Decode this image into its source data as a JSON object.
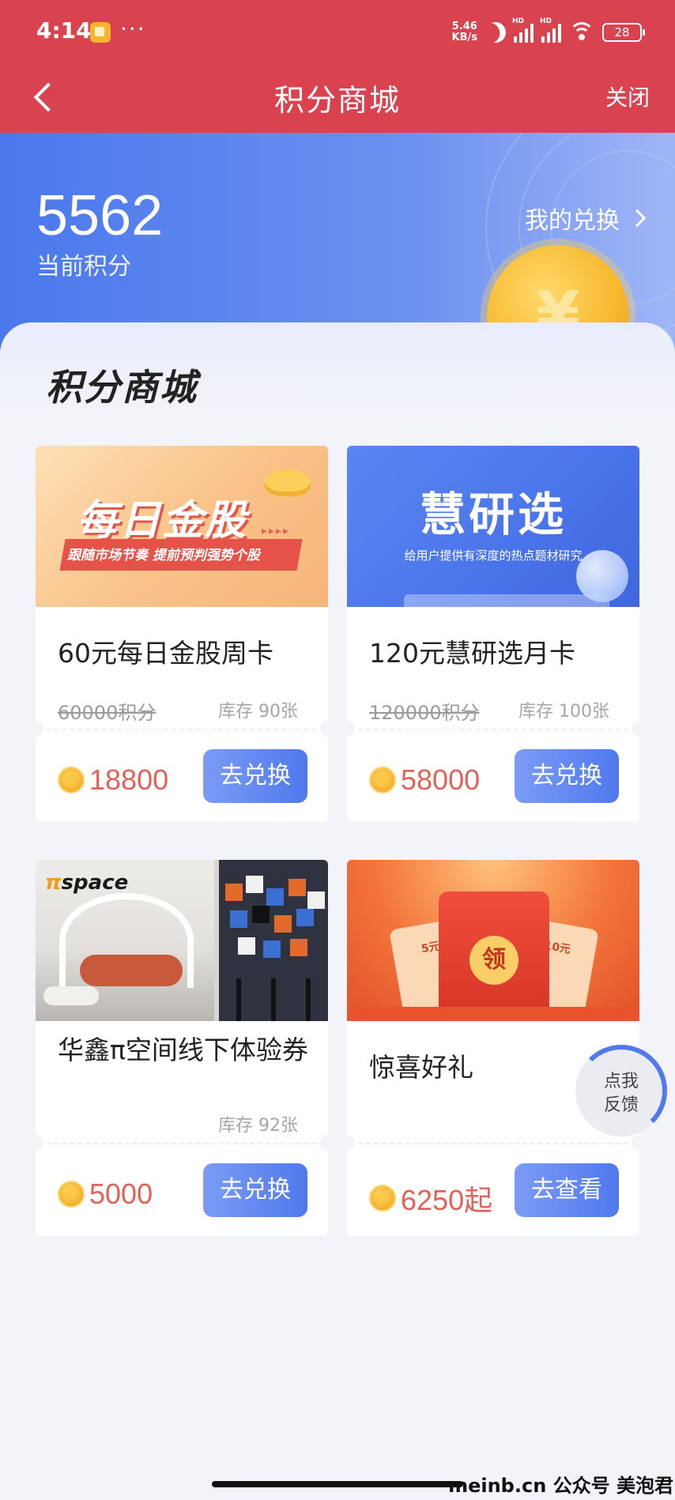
{
  "status_bar": {
    "time": "4:14",
    "dots": "···",
    "net_speed_value": "5.46",
    "net_speed_unit": "KB/s",
    "battery": "28",
    "signal_badge": "HD",
    "icons": [
      "app-icon",
      "moon-icon",
      "signal-icon",
      "signal-icon",
      "wifi-icon",
      "battery-icon"
    ]
  },
  "nav": {
    "title": "积分商城",
    "close_label": "关闭",
    "back_icon": "back-icon"
  },
  "hero": {
    "points": "5562",
    "points_label": "当前积分",
    "my_exchange_label": "我的兑换"
  },
  "section": {
    "title": "积分商城"
  },
  "products": [
    {
      "name": "60元每日金股周卡",
      "original_price": "60000积分",
      "stock": "库存 90张",
      "price": "18800",
      "button": "去兑换",
      "banner_title": "每日金股",
      "banner_subtitle": "跟随市场节奏 提前预判强势个股"
    },
    {
      "name": "120元慧研选月卡",
      "original_price": "120000积分",
      "stock": "库存 100张",
      "price": "58000",
      "button": "去兑换",
      "banner_title": "慧研选",
      "banner_subtitle": "给用户提供有深度的热点题材研究"
    },
    {
      "name": "华鑫π空间线下体验券",
      "stock": "库存 92张",
      "price": "5000",
      "button": "去兑换",
      "banner_logo_pi": "π",
      "banner_logo_text": "space"
    },
    {
      "name": "惊喜好礼",
      "price": "6250起",
      "button": "去查看",
      "banner_seal": "领",
      "banner_left_amount": "5元",
      "banner_right_amount": "10元"
    }
  ],
  "feedback": {
    "label": "点我反馈"
  },
  "watermark": "meinb.cn  公众号 美泡君",
  "colors": {
    "header_red": "#d8434f",
    "hero_blue": "#4a78ec",
    "price_red": "#e06358",
    "button_blue": "#4f79ec"
  }
}
